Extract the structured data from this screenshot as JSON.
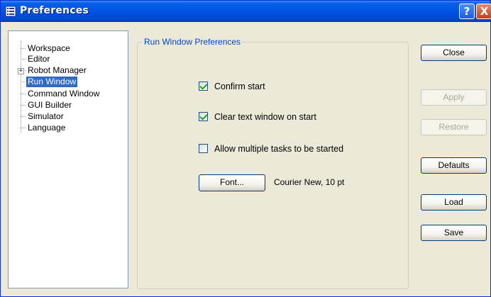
{
  "window": {
    "title": "Preferences",
    "help_label": "?",
    "close_label": "X"
  },
  "tree": {
    "items": [
      {
        "label": "Workspace"
      },
      {
        "label": "Editor"
      },
      {
        "label": "Robot Manager",
        "expander": "+"
      },
      {
        "label": "Run Window",
        "selected": true
      },
      {
        "label": "Command Window"
      },
      {
        "label": "GUI Builder"
      },
      {
        "label": "Simulator"
      },
      {
        "label": "Language"
      }
    ]
  },
  "panel": {
    "title": "Run Window Preferences",
    "options": [
      {
        "label": "Confirm start",
        "checked": true
      },
      {
        "label": "Clear text window on start",
        "checked": true
      },
      {
        "label": "Allow multiple tasks to be started",
        "checked": false
      }
    ],
    "font_button": "Font...",
    "font_value": "Courier New, 10 pt"
  },
  "buttons": {
    "close": "Close",
    "apply": "Apply",
    "restore": "Restore",
    "defaults": "Defaults",
    "load": "Load",
    "save": "Save"
  },
  "colors": {
    "titlebar": "#0055e5",
    "selection": "#316ac5",
    "group_title": "#0046d5",
    "check": "#21a121"
  }
}
